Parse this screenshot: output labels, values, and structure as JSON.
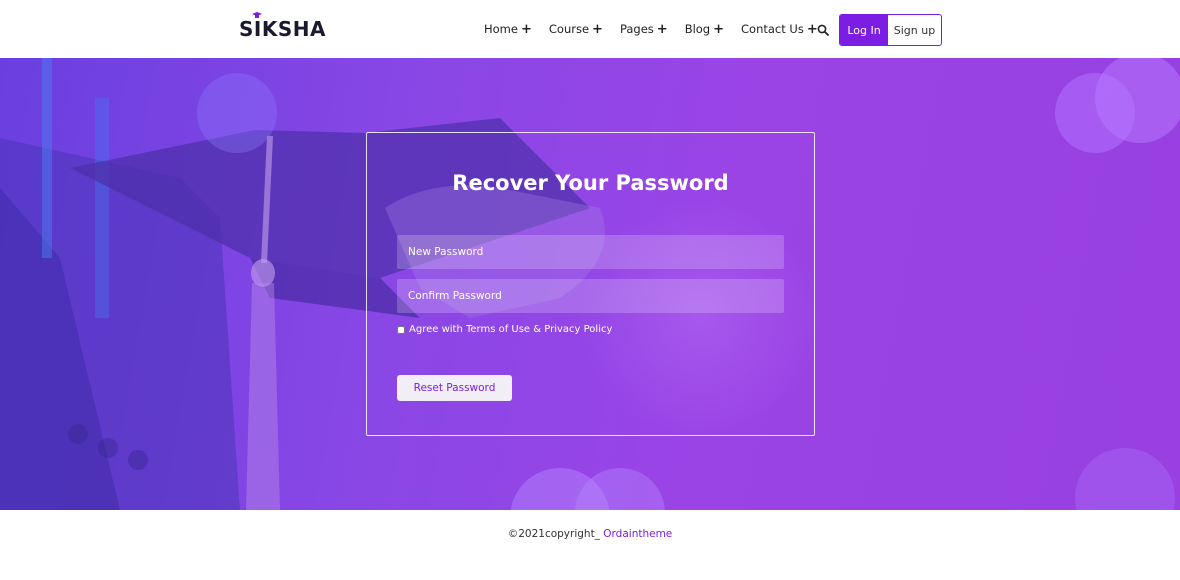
{
  "brand": {
    "logo_text": "SIKSHA",
    "accent_color": "#7c1de3"
  },
  "nav": {
    "items": [
      {
        "label": "Home",
        "suffix": "+"
      },
      {
        "label": "Course",
        "suffix": "+"
      },
      {
        "label": "Pages",
        "suffix": "+"
      },
      {
        "label": "Blog",
        "suffix": "+"
      },
      {
        "label": "Contact Us",
        "suffix": "+"
      }
    ],
    "search_icon": "search-icon",
    "login_label": "Log In",
    "signup_label": "Sign up"
  },
  "form": {
    "title": "Recover Your Password",
    "new_password_placeholder": "New Password",
    "confirm_password_placeholder": "Confirm Password",
    "agree_label": "Agree with Terms of Use & Privacy Policy",
    "agree_checked": false,
    "reset_label": "Reset Password"
  },
  "footer": {
    "copyright": "©2021copyright_",
    "brand_link": "Ordaintheme"
  }
}
